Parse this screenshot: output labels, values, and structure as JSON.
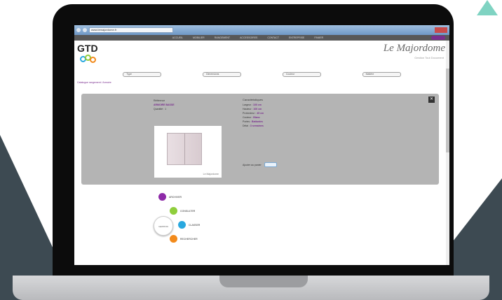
{
  "browser": {
    "url": "www.lemajordome.fr"
  },
  "menu": {
    "items": [
      "ACCUEIL",
      "MOBILIER",
      "RANGEMENT",
      "ACCESSOIRES",
      "CONTACT",
      "ENTREPRISE",
      "PANIER"
    ]
  },
  "header": {
    "logo_text": "GTD",
    "brand_name": "Le Majordome",
    "brand_subtitle": "Gestion Tout Document"
  },
  "filters": [
    {
      "label": "Type"
    },
    {
      "label": "Dimensions"
    },
    {
      "label": "Couleur"
    },
    {
      "label": "Matière"
    }
  ],
  "breadcrumb": "Catalogue rangement / Armoire",
  "product": {
    "ref_label": "Référence",
    "ref_value": "ARMOIRE BASSE",
    "qty_label": "Quantité : 1",
    "photo_caption": "Le Majordome",
    "specs_title": "Caractéristiques",
    "spec_rows": [
      {
        "key": "Largeur :",
        "value": "100 cm"
      },
      {
        "key": "Hauteur :",
        "value": "100 cm"
      },
      {
        "key": "Profondeur :",
        "value": "45 cm"
      },
      {
        "key": "Couleur :",
        "value": "Blanc"
      },
      {
        "key": "Portes :",
        "value": "Battantes"
      },
      {
        "key": "Délai :",
        "value": "3 semaines"
      }
    ],
    "add_label": "Ajouter au panier"
  },
  "steps": {
    "center": "GESTION",
    "items": [
      {
        "label": "ARCHIVER",
        "color": "#8e2aa8"
      },
      {
        "label": "CONSULTER",
        "color": "#8fce3c"
      },
      {
        "label": "CLASSER",
        "color": "#29a8df"
      },
      {
        "label": "RECHERCHER",
        "color": "#f28a1b"
      }
    ]
  },
  "colors": {
    "accent": "#7a2e8e",
    "panel": "#b4b4b4",
    "slate": "#3d4a52",
    "teal": "#7fd3c2"
  }
}
